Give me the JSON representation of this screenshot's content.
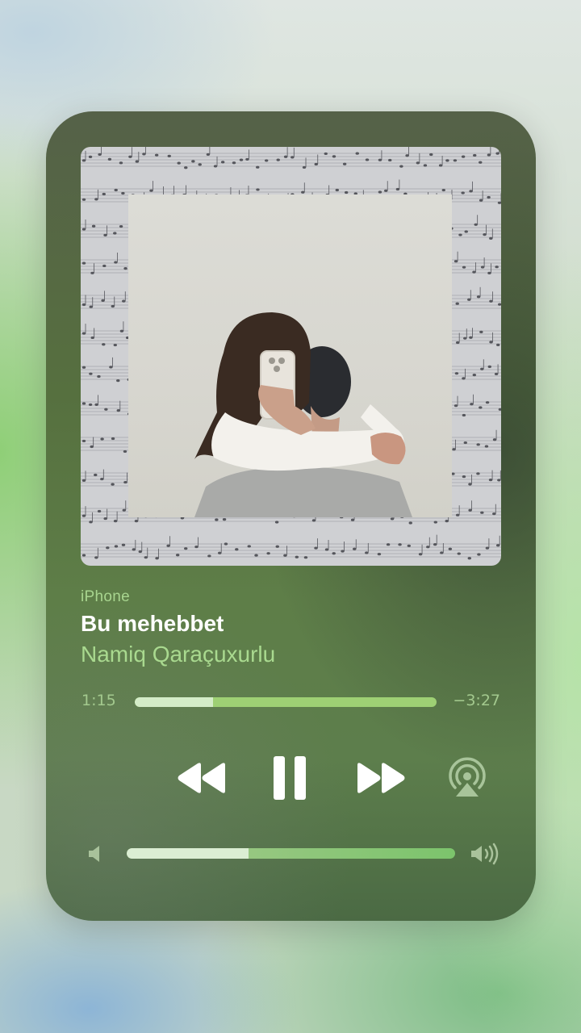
{
  "now_playing": {
    "source": "iPhone",
    "title": "Bu mehebbet",
    "artist": "Namiq Qaraçuxurlu"
  },
  "progress": {
    "elapsed": "1:15",
    "remaining": "−3:27",
    "fraction": 0.26
  },
  "volume": {
    "fraction": 0.37
  },
  "controls": {
    "rewind_icon": "backward-icon",
    "pause_icon": "pause-icon",
    "forward_icon": "forward-icon",
    "airplay_icon": "airplay-icon",
    "volume_low_icon": "speaker-low-icon",
    "volume_high_icon": "speaker-high-icon"
  },
  "colors": {
    "accent_green": "#a9d98f",
    "title_white": "#ffffff"
  }
}
